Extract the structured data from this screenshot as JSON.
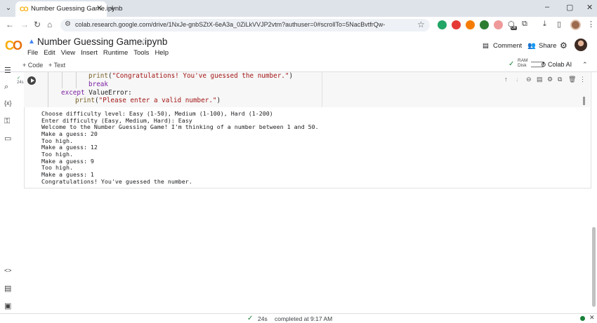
{
  "browser": {
    "tab_title": "Number Guessing Game.ipynb",
    "tab_logo": "CO",
    "url": "colab.research.google.com/drive/1NxJe-gnbSZtX-6eA3a_0ZiLkVVJP2vtm?authuser=0#scrollTo=5NacBvtfrQw-",
    "icons": {
      "tab_menu": "chevron-down-icon",
      "close": "close-icon",
      "new_tab": "plus-icon",
      "back": "back-arrow-icon",
      "forward": "forward-arrow-icon",
      "reload": "reload-icon",
      "home": "home-icon",
      "site_info": "site-info-icon",
      "bookmark": "star-icon",
      "downloads": "download-icon",
      "split": "split-view-icon",
      "menu": "more-vert-icon"
    },
    "window_controls": {
      "minimize": "–",
      "maximize": "▢",
      "close": "✕"
    },
    "extension_colors": [
      "#22a565",
      "#e53935",
      "#f57c00",
      "#2e7d32",
      "#d32f2f"
    ],
    "off_badge": "Off"
  },
  "colab": {
    "logo": "CO",
    "notebook_title": "Number Guessing Game.ipynb",
    "menu": [
      "File",
      "Edit",
      "View",
      "Insert",
      "Runtime",
      "Tools",
      "Help"
    ],
    "comment_label": "Comment",
    "share_label": "Share",
    "toolbar": {
      "add_code": "+ Code",
      "add_text": "+ Text",
      "ram_label": "RAM",
      "disk_label": "Disk",
      "colab_ai": "Colab AI"
    }
  },
  "cell": {
    "exec_time": "24s",
    "code_lines": {
      "l1_fn": "print",
      "l1_str": "\"Congratulations! You've guessed the number.\"",
      "l2_kw": "break",
      "l3_kw": "except",
      "l3_name": " ValueError:",
      "l4_fn": "print",
      "l4_str": "\"Please enter a valid number.\""
    },
    "output_lines": [
      "Choose difficulty level: Easy (1-50), Medium (1-100), Hard (1-200)",
      "Enter difficulty (Easy, Medium, Hard): Easy",
      "Welcome to the Number Guessing Game! I'm thinking of a number between 1 and 50.",
      "Make a guess: 20",
      "Too high.",
      "Make a guess: 12",
      "Too high.",
      "Make a guess: 9",
      "Too high.",
      "Make a guess: 1",
      "Congratulations! You've guessed the number."
    ]
  },
  "status_bar": {
    "elapsed": "24s",
    "completed": "completed at 9:17 AM"
  }
}
